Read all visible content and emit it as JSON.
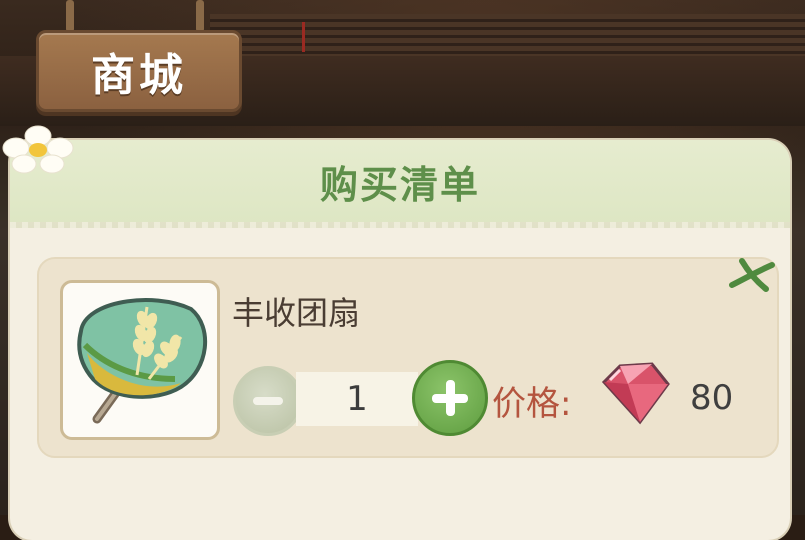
{
  "sign": {
    "title": "商城"
  },
  "panel": {
    "title": "购买清单"
  },
  "item": {
    "name": "丰收团扇",
    "quantity": "1",
    "price_label": "价格:",
    "price_value": "80",
    "currency_icon": "ruby-gem-icon",
    "thumbnail_icon": "harvest-fan-icon"
  },
  "icons": {
    "decrement": "minus-icon",
    "increment": "plus-icon",
    "close": "close-icon",
    "decoration": "flower-icon"
  },
  "colors": {
    "title_green": "#5e8f4a",
    "price_red": "#b4553f",
    "plus_green": "#5e9d3f",
    "minus_disabled": "#b9c1a3",
    "panel_bg": "#f4efe2"
  }
}
